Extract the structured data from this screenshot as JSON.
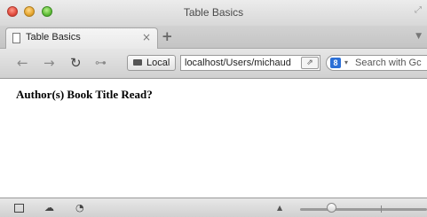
{
  "window": {
    "title": "Table Basics"
  },
  "tab": {
    "label": "Table Basics",
    "close_glyph": "×"
  },
  "new_tab_glyph": "+",
  "tab_list_glyph": "▼",
  "toolbar": {
    "back_glyph": "←",
    "forward_glyph": "→",
    "reload_glyph": "↻",
    "key_glyph": "⊶",
    "local_label": "Local",
    "url": "localhost/Users/michaud",
    "share_glyph": "⇗",
    "search_engine_glyph": "8",
    "search_caret": "▾",
    "search_placeholder": "Search with Gc"
  },
  "page": {
    "table_header": "Author(s) Book Title Read?"
  },
  "statusbar": {
    "zoom_level": 0.25,
    "zoom_caret": "▲"
  },
  "icons": [
    "page-icon",
    "close-icon",
    "new-tab-icon",
    "back-icon",
    "forward-icon",
    "reload-icon",
    "key-icon",
    "local-icon",
    "share-icon",
    "google-icon",
    "console-icon",
    "cloud-icon",
    "gauge-icon"
  ]
}
